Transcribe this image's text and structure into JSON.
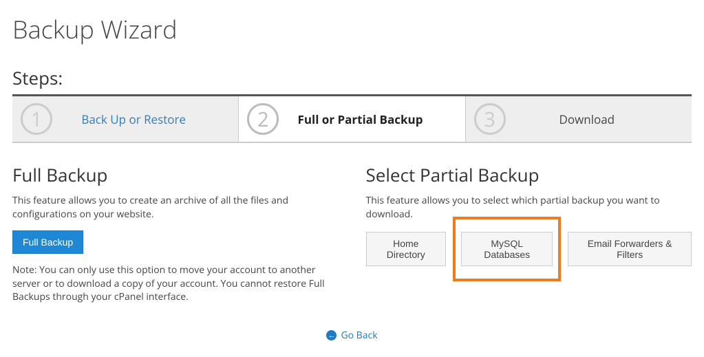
{
  "page": {
    "title": "Backup Wizard",
    "steps_label": "Steps:"
  },
  "steps": [
    {
      "num": "1",
      "label": "Back Up or Restore",
      "state": "completed"
    },
    {
      "num": "2",
      "label": "Full or Partial Backup",
      "state": "active"
    },
    {
      "num": "3",
      "label": "Download",
      "state": "upcoming"
    }
  ],
  "full_backup": {
    "title": "Full Backup",
    "desc": "This feature allows you to create an archive of all the files and configurations on your website.",
    "button": "Full Backup",
    "note": "Note: You can only use this option to move your account to another server or to download a copy of your account. You cannot restore Full Backups through your cPanel interface."
  },
  "partial_backup": {
    "title": "Select Partial Backup",
    "desc": "This feature allows you to select which partial backup you want to download.",
    "buttons": {
      "home": "Home Directory",
      "mysql": "MySQL Databases",
      "email": "Email Forwarders & Filters"
    }
  },
  "footer": {
    "goback": "Go Back"
  }
}
